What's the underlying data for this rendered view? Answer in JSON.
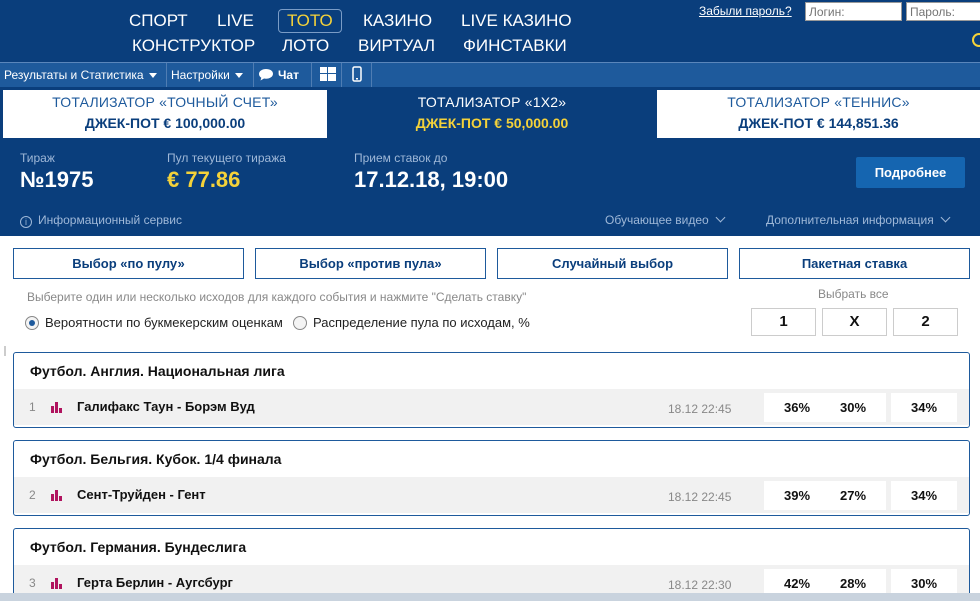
{
  "nav": {
    "row1": [
      "СПОРТ",
      "LIVE",
      "ТОТО",
      "КАЗИНО",
      "LIVE КАЗИНО"
    ],
    "row2": [
      "КОНСТРУКТОР",
      "ЛОТО",
      "ВИРТУАЛ",
      "ФИНСТАВКИ"
    ],
    "active": "ТОТО",
    "forgot_password": "Забыли пароль?",
    "login_placeholder": "Логин:",
    "password_placeholder": "Пароль:"
  },
  "toolbar": {
    "results": "Результаты и Статистика",
    "settings": "Настройки",
    "chat": "Чат"
  },
  "tabs": [
    {
      "title": "ТОТАЛИЗАТОР «ТОЧНЫЙ СЧЕТ»",
      "jackpot": "ДЖЕК-ПОТ € 100,000.00"
    },
    {
      "title": "ТОТАЛИЗАТОР «1X2»",
      "jackpot": "ДЖЕК-ПОТ € 50,000.00"
    },
    {
      "title": "ТОТАЛИЗАТОР «ТЕННИС»",
      "jackpot": "ДЖЕК-ПОТ € 144,851.36"
    }
  ],
  "active_tab": 1,
  "draw": {
    "draw_label": "Тираж",
    "draw_value": "№1975",
    "pool_label": "Пул текущего тиража",
    "pool_value": "€ 77.86",
    "deadline_label": "Прием ставок до",
    "deadline_value": "17.12.18, 19:00",
    "more_button": "Подробнее",
    "info_service": "Информационный сервис",
    "tutorial_video": "Обучающее видео",
    "additional_info": "Дополнительная информация"
  },
  "selection_buttons": [
    "Выбор «по пулу»",
    "Выбор «против пула»",
    "Случайный выбор",
    "Пакетная ставка"
  ],
  "hint": "Выберите один или несколько исходов для каждого события и нажмите \"Сделать ставку\"",
  "radios": [
    {
      "label": "Вероятности по букмекерским оценкам",
      "selected": true
    },
    {
      "label": "Распределение пула по исходам, %",
      "selected": false
    }
  ],
  "choose_all": {
    "label": "Выбрать все",
    "options": [
      "1",
      "X",
      "2"
    ]
  },
  "events": [
    {
      "league": "Футбол. Англия. Национальная лига",
      "num": "1",
      "match": "Галифакс Таун - Борэм Вуд",
      "date": "18.12 22:45",
      "odds": [
        "36%",
        "30%",
        "34%"
      ]
    },
    {
      "league": "Футбол. Бельгия. Кубок. 1/4 финала",
      "num": "2",
      "match": "Сент-Труйден - Гент",
      "date": "18.12 22:45",
      "odds": [
        "39%",
        "27%",
        "34%"
      ]
    },
    {
      "league": "Футбол. Германия. Бундеслига",
      "num": "3",
      "match": "Герта Берлин - Аугсбург",
      "date": "18.12 22:30",
      "odds": [
        "42%",
        "28%",
        "30%"
      ]
    }
  ],
  "colors": {
    "primary": "#0a3e7c",
    "accent": "#f4d23a",
    "button": "#1565b0",
    "bars": "#b0135e"
  }
}
